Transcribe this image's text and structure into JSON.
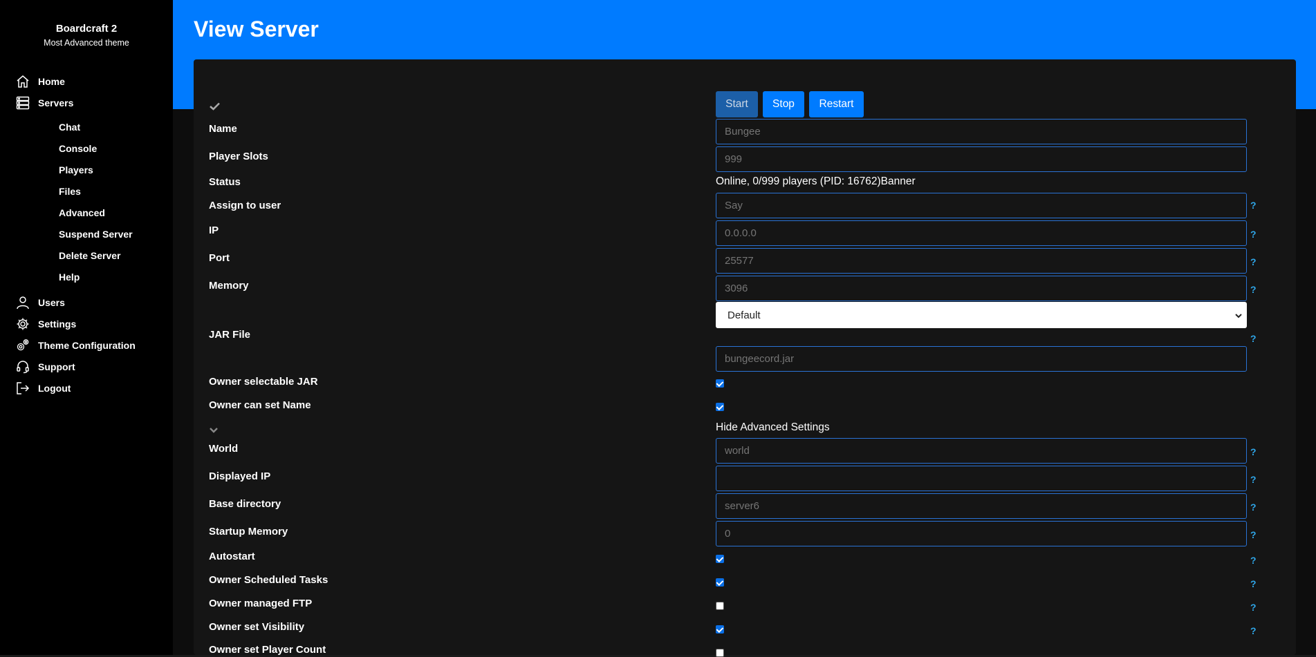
{
  "sidebar": {
    "brand": "Boardcraft 2",
    "brand_sub": "Most Advanced theme",
    "items": [
      {
        "label": "Home",
        "icon": "home-icon"
      },
      {
        "label": "Servers",
        "icon": "server-icon"
      },
      {
        "label": "Users",
        "icon": "user-icon"
      },
      {
        "label": "Settings",
        "icon": "gear-icon"
      },
      {
        "label": "Theme Configuration",
        "icon": "gears-icon"
      },
      {
        "label": "Support",
        "icon": "headset-icon"
      },
      {
        "label": "Logout",
        "icon": "logout-icon"
      }
    ],
    "sub_items": [
      "Chat",
      "Console",
      "Players",
      "Files",
      "Advanced",
      "Suspend Server",
      "Delete Server",
      "Help"
    ]
  },
  "header": {
    "title": "View Server"
  },
  "controls": {
    "start": "Start",
    "stop": "Stop",
    "restart": "Restart"
  },
  "form": {
    "name": {
      "label": "Name",
      "placeholder": "Bungee"
    },
    "player_slots": {
      "label": "Player Slots",
      "placeholder": "999"
    },
    "status": {
      "label": "Status",
      "value": "Online, 0/999 players (PID: 16762)Banner"
    },
    "assign_user": {
      "label": "Assign to user",
      "placeholder": "Say"
    },
    "ip": {
      "label": "IP",
      "placeholder": "0.0.0.0"
    },
    "port": {
      "label": "Port",
      "placeholder": "25577"
    },
    "memory": {
      "label": "Memory",
      "placeholder": "3096"
    },
    "jar_file": {
      "label": "JAR File",
      "select_value": "Default",
      "placeholder": "bungeecord.jar"
    },
    "owner_selectable_jar": {
      "label": "Owner selectable JAR",
      "checked": true
    },
    "owner_set_name": {
      "label": "Owner can set Name",
      "checked": true
    },
    "hide_advanced": "Hide Advanced Settings",
    "world": {
      "label": "World",
      "placeholder": "world"
    },
    "displayed_ip": {
      "label": "Displayed IP",
      "placeholder": ""
    },
    "base_directory": {
      "label": "Base directory",
      "placeholder": "server6"
    },
    "startup_memory": {
      "label": "Startup Memory",
      "placeholder": "0"
    },
    "autostart": {
      "label": "Autostart",
      "checked": true
    },
    "owner_scheduled_tasks": {
      "label": "Owner Scheduled Tasks",
      "checked": true
    },
    "owner_managed_ftp": {
      "label": "Owner managed FTP",
      "checked": false
    },
    "owner_set_visibility": {
      "label": "Owner set Visibility",
      "checked": true
    },
    "owner_set_player_count": {
      "label": "Owner set Player Count",
      "checked": false
    }
  },
  "help_glyph": "?",
  "colors": {
    "accent": "#007bff",
    "button_start": "#1c5fa8",
    "sidebar_bg": "#000000",
    "card_bg": "#151515"
  }
}
